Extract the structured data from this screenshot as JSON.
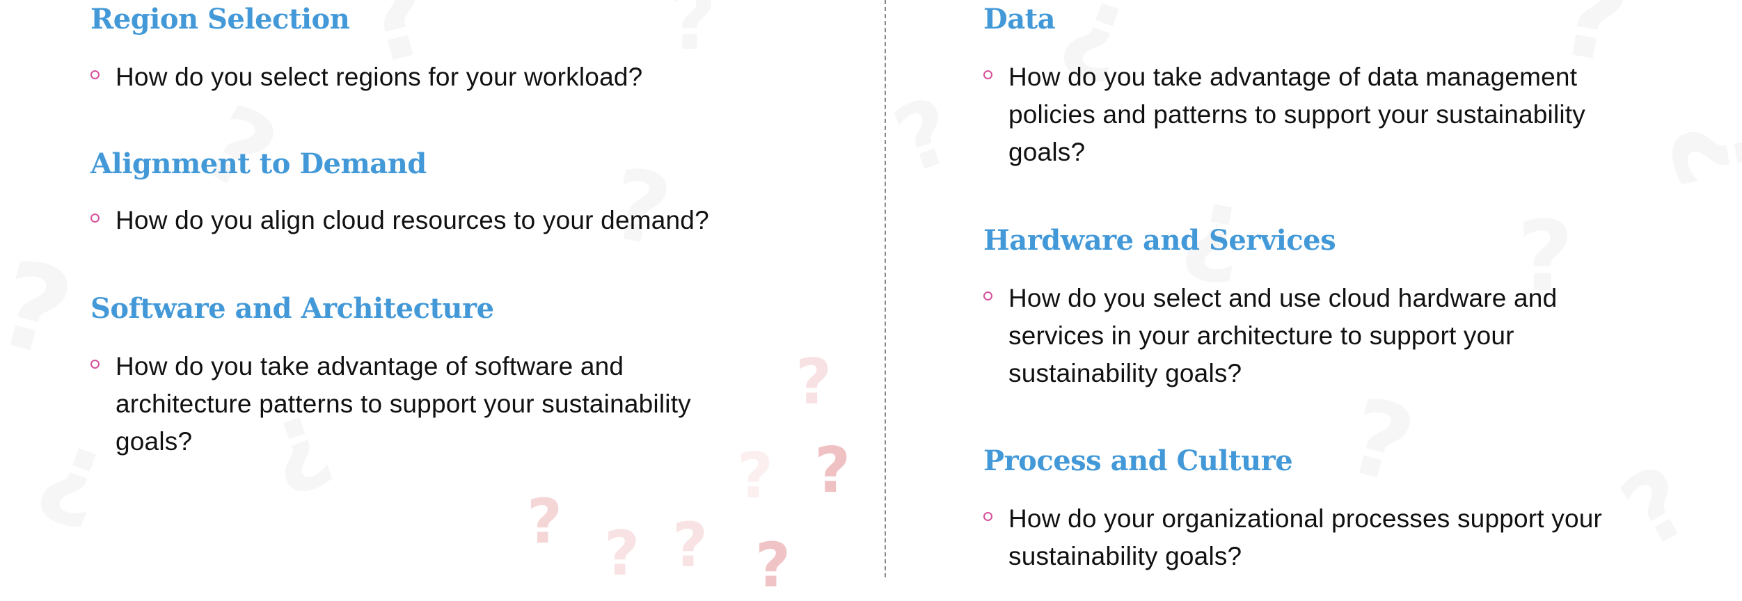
{
  "colors": {
    "heading": "#4399d8",
    "bullet": "#d6519b",
    "body_text": "#111111",
    "divider": "#8a8a8a",
    "decor_question_light": "#f6f6f6",
    "decor_question_pink": "#f0c4c6"
  },
  "decor": {
    "question_glyph": "?"
  },
  "left_column": {
    "sections": [
      {
        "heading": "Region Selection",
        "questions": [
          "How do you select regions for your workload?"
        ]
      },
      {
        "heading": "Alignment to Demand",
        "questions": [
          "How do you align cloud resources to your demand?"
        ]
      },
      {
        "heading": "Software and Architecture",
        "questions": [
          "How do you take advantage of software and architecture patterns to support your sustainability goals?"
        ]
      }
    ]
  },
  "right_column": {
    "sections": [
      {
        "heading": "Data",
        "questions": [
          "How do you take advantage of data management policies and patterns to support your sustainability goals?"
        ]
      },
      {
        "heading": "Hardware and Services",
        "questions": [
          "How do you select and use cloud hardware and services in your architecture to support your sustainability goals?"
        ]
      },
      {
        "heading": "Process and Culture",
        "questions": [
          "How do your organizational processes support your sustainability goals?"
        ]
      }
    ]
  }
}
